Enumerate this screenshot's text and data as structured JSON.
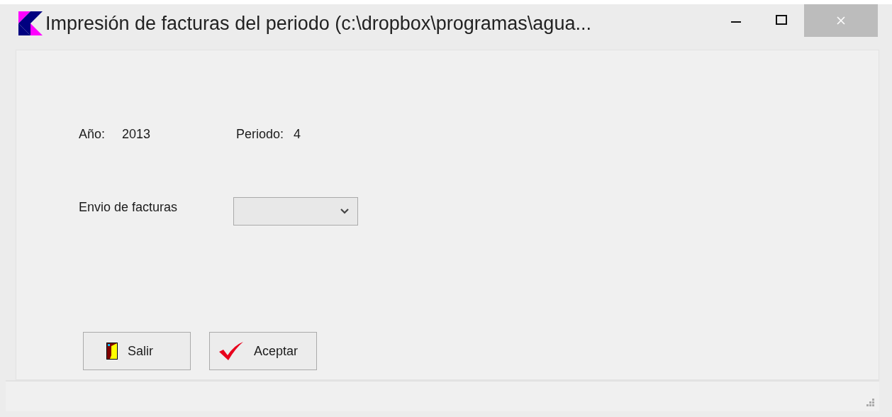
{
  "window": {
    "title": "Impresión de facturas del periodo (c:\\dropbox\\programas\\agua..."
  },
  "info": [
    {
      "label": "Año:",
      "value": "2013"
    },
    {
      "label": "Periodo:",
      "value": "4"
    }
  ],
  "dropdown": {
    "label": "Envio de facturas"
  },
  "buttons": [
    {
      "label": "Salir",
      "kind": "exit"
    },
    {
      "label": "Aceptar",
      "kind": "confirm"
    }
  ]
}
